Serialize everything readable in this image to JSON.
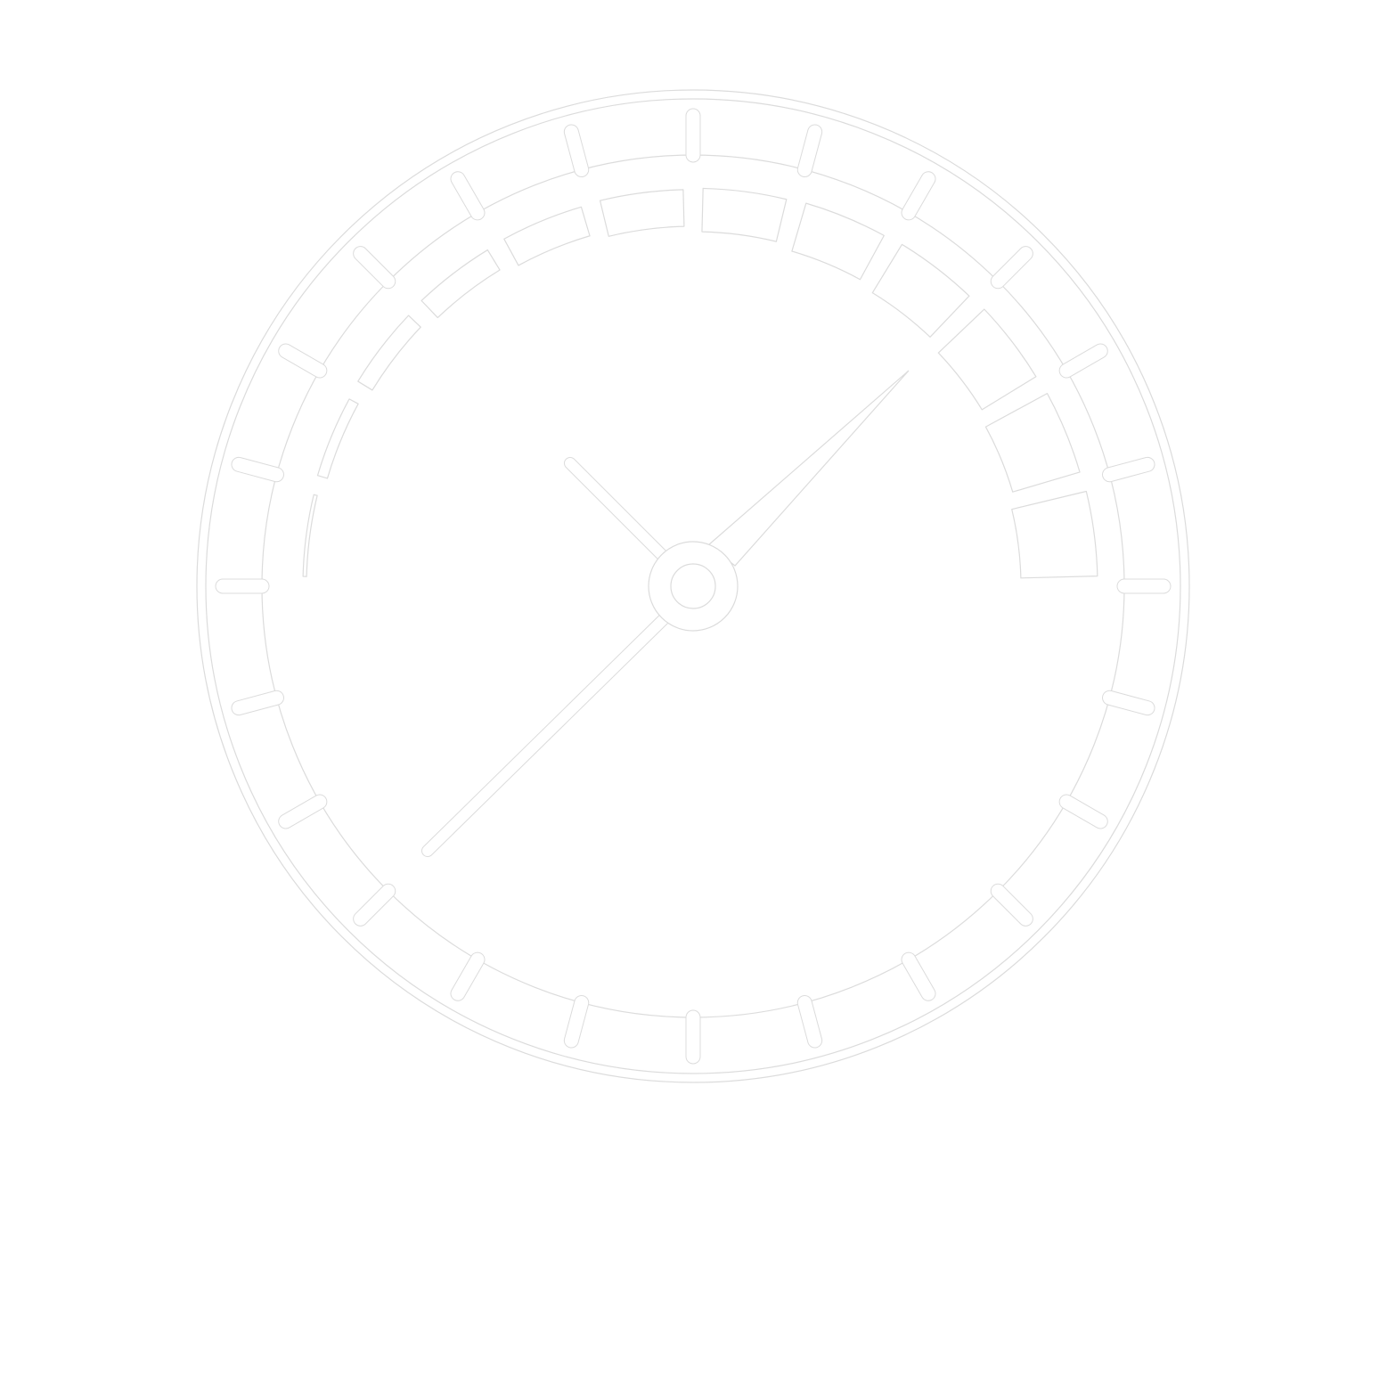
{
  "icon": "gauge-clock-icon",
  "colors": {
    "background": "#ffffff",
    "fill": "#ffffff",
    "stroke": "#dcdcdc"
  },
  "ticks": 24,
  "gauge_segments": 12
}
